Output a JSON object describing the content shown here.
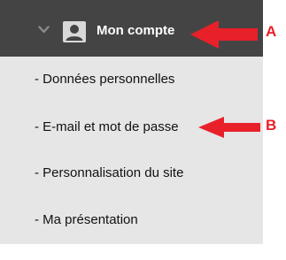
{
  "header": {
    "title": "Mon compte",
    "chevron_icon": "chevron-down-icon",
    "user_icon": "user-avatar-icon"
  },
  "menu": {
    "items": [
      {
        "label": "- Données personnelles"
      },
      {
        "label": "- E-mail et mot de passe"
      },
      {
        "label": "- Personnalisation du site"
      },
      {
        "label": "- Ma présentation"
      }
    ]
  },
  "annotations": [
    {
      "label": "A"
    },
    {
      "label": "B"
    }
  ],
  "colors": {
    "header_bg": "#444444",
    "panel_bg": "#e6e6e6",
    "annotation_red": "#e8202a"
  }
}
